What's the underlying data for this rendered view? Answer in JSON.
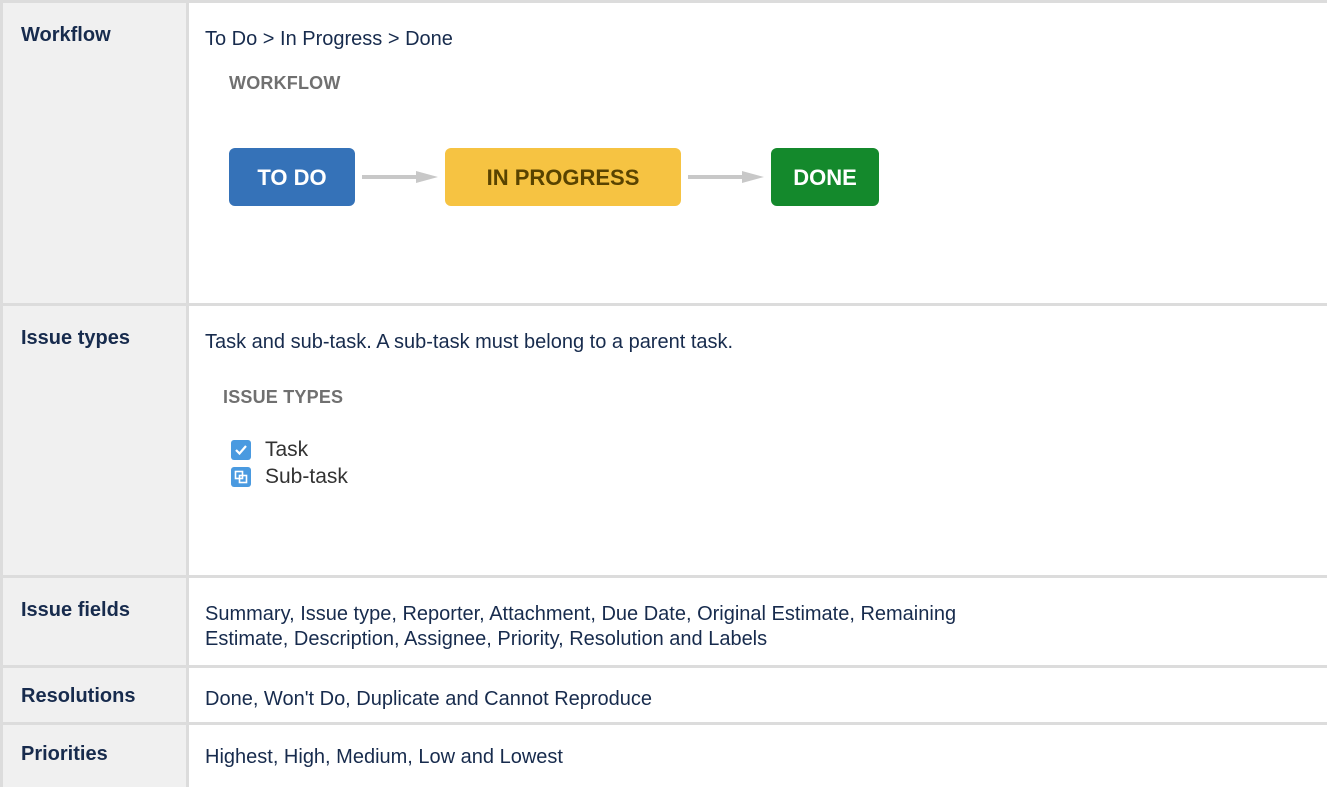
{
  "rows": {
    "workflow": {
      "label": "Workflow",
      "text": "To Do > In Progress > Done",
      "subheading": "WORKFLOW",
      "statuses": [
        "TO DO",
        "IN PROGRESS",
        "DONE"
      ],
      "colors": {
        "todo": "#3572b8",
        "in_progress": "#f6c342",
        "done": "#14892c"
      }
    },
    "issue_types": {
      "label": "Issue types",
      "text": "Task and sub-task. A sub-task must belong to a parent task.",
      "subheading": "ISSUE TYPES",
      "items": [
        {
          "label": "Task",
          "icon": "checkbox-icon"
        },
        {
          "label": "Sub-task",
          "icon": "subtask-icon"
        }
      ]
    },
    "issue_fields": {
      "label": "Issue fields",
      "text_line1": "Summary, Issue type, Reporter, Attachment, Due Date, Original Estimate, Remaining",
      "text_line2": "Estimate, Description, Assignee, Priority, Resolution and Labels"
    },
    "resolutions": {
      "label": "Resolutions",
      "text": "Done, Won't Do, Duplicate and Cannot Reproduce"
    },
    "priorities": {
      "label": "Priorities",
      "text": "Highest, High, Medium, Low and Lowest"
    }
  }
}
